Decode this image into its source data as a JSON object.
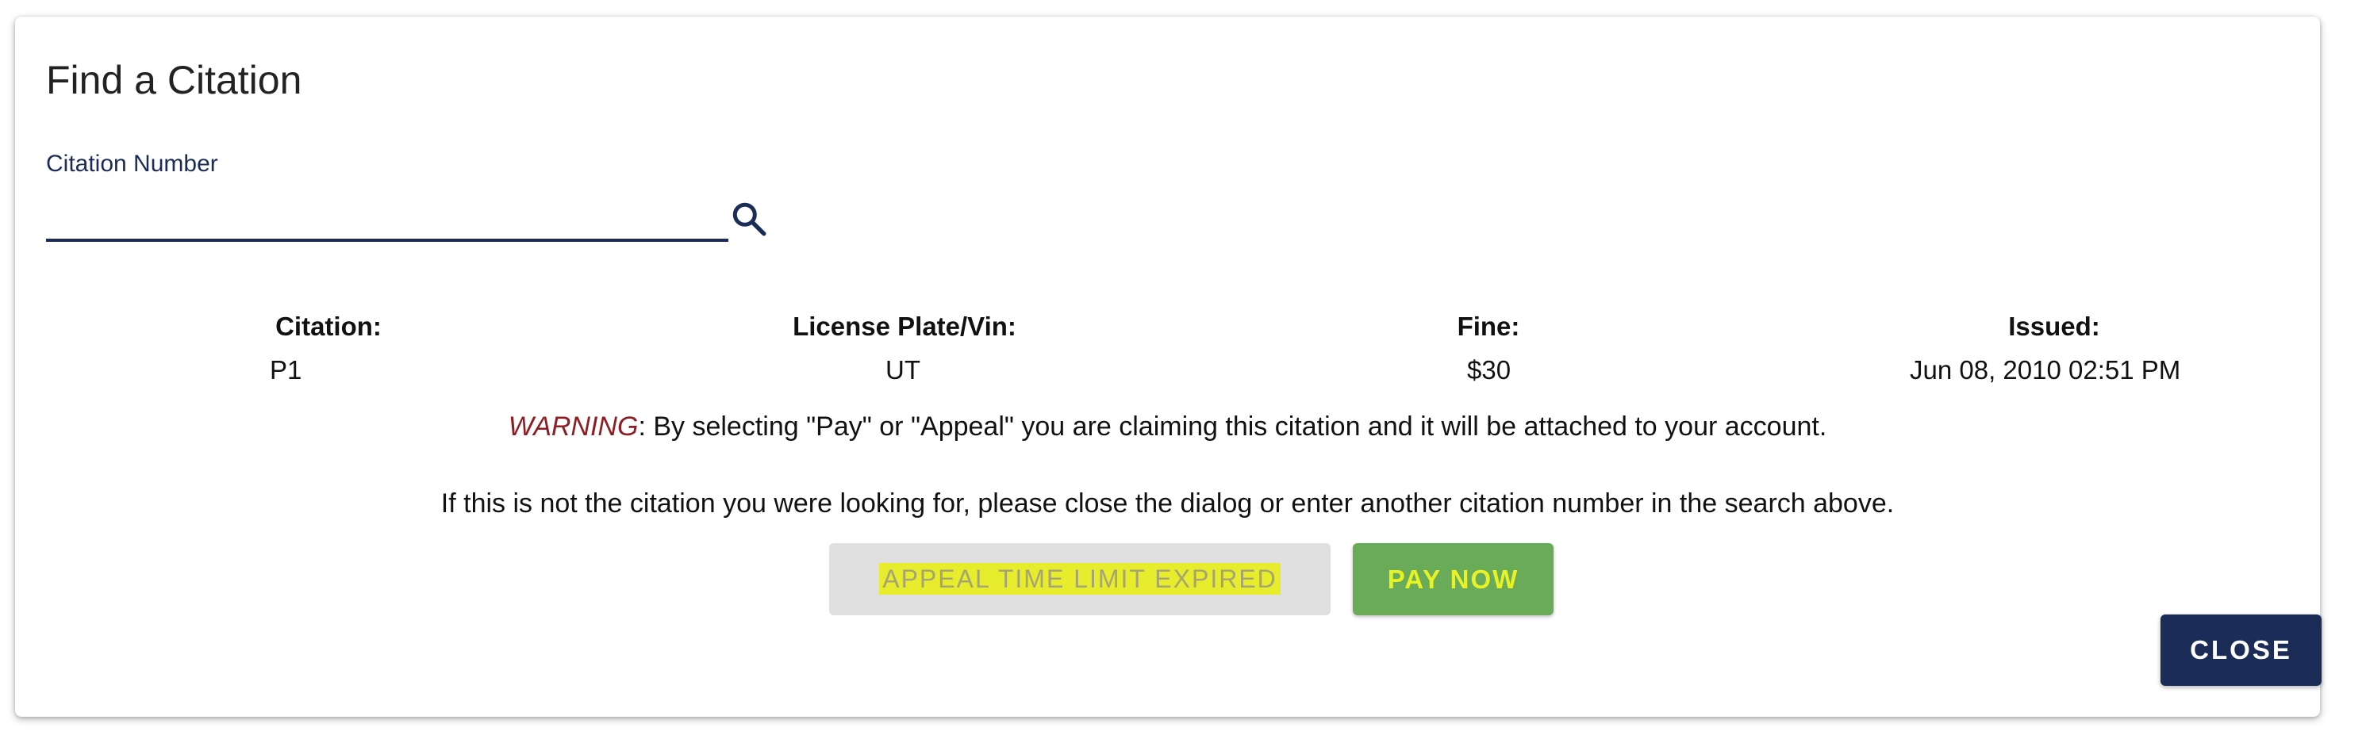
{
  "dialog": {
    "title": "Find a Citation",
    "search": {
      "label": "Citation Number",
      "value": "",
      "placeholder": ""
    },
    "citation_table": {
      "headers": {
        "citation": "Citation:",
        "plate": "License Plate/Vin:",
        "fine": "Fine:",
        "issued": "Issued:"
      },
      "values": {
        "citation": "P1",
        "plate": "UT",
        "fine": "$30",
        "issued": "Jun 08, 2010 02:51 PM"
      }
    },
    "warning": {
      "prefix": "WARNING",
      "text": ": By selecting \"Pay\" or \"Appeal\" you are claiming this citation and it will be attached to your account."
    },
    "info_text": "If this is not the citation you were looking for, please close the dialog or enter another citation number in the search above.",
    "buttons": {
      "appeal": "APPEAL TIME LIMIT EXPIRED",
      "pay": "PAY NOW",
      "close": "CLOSE"
    },
    "colors": {
      "primary": "#1b2c57",
      "pay_button": "#6aab59",
      "warning_text": "#8e1d24",
      "highlight": "#e8ee1e"
    }
  }
}
